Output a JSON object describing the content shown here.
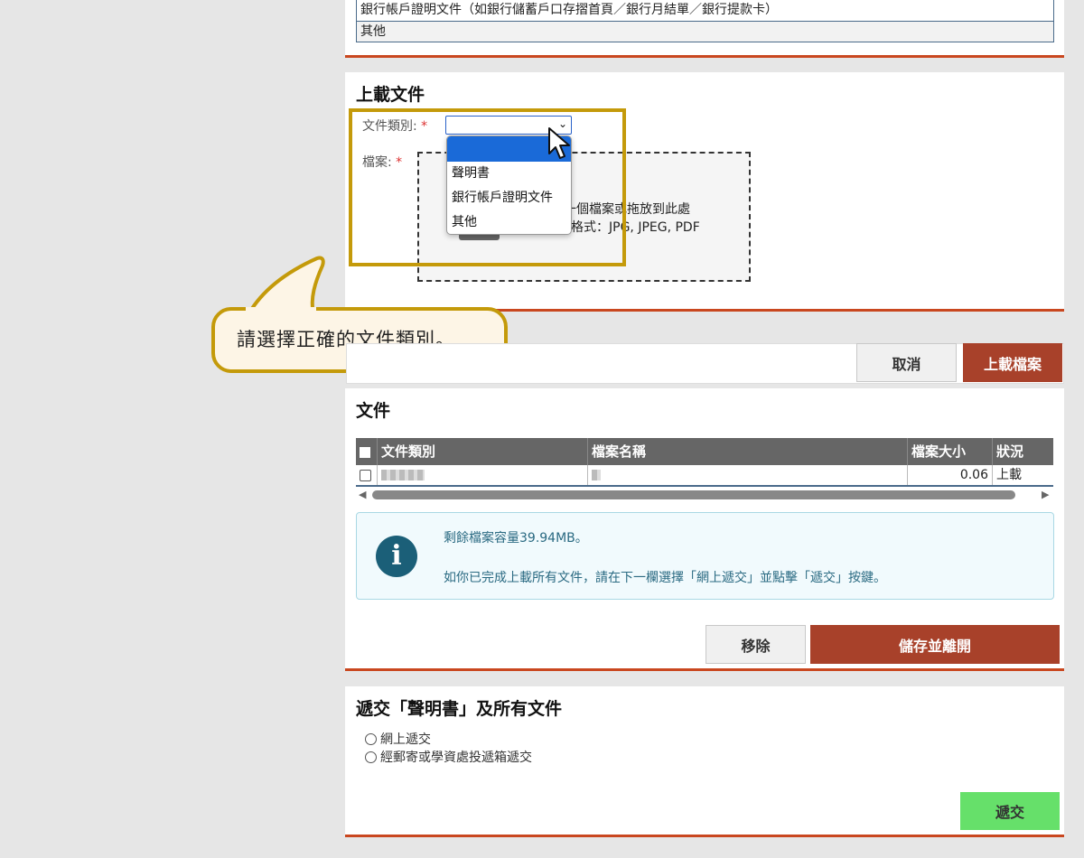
{
  "top_list": {
    "items": [
      "銀行帳戶證明文件（如銀行儲蓄戶口存摺首頁／銀行月結單／銀行提款卡）",
      "其他"
    ]
  },
  "upload_section": {
    "title": "上載文件",
    "category_label": "文件類別:",
    "file_label": "檔案:",
    "required_mark": "*",
    "select_value": "",
    "dropdown_options": [
      "",
      "聲明書",
      "銀行帳戶證明文件",
      "其他"
    ],
    "drop_zone_line1": "一個檔案或拖放到此處",
    "drop_zone_line2": "格式：JPG, JPEG, PDF"
  },
  "callout": {
    "text": "請選擇正確的文件類別。",
    "border_color": "#c49a0a"
  },
  "upload_actions": {
    "cancel_label": "取消",
    "upload_label": "上載檔案"
  },
  "documents": {
    "title": "文件",
    "columns": [
      "文件類別",
      "檔案名稱",
      "檔案大小",
      "狀況"
    ],
    "rows": [
      {
        "category": "",
        "filename": "",
        "size": "0.06",
        "status": "上載"
      }
    ],
    "info_line1": "剩餘檔案容量39.94MB。",
    "info_line2": "如你已完成上載所有文件，請在下一欄選擇「網上遞交」並點擊「遞交」按鍵。",
    "remove_label": "移除",
    "save_exit_label": "儲存並離開"
  },
  "submit_section": {
    "title": "遞交「聲明書」及所有文件",
    "options": [
      "網上遞交",
      "經郵寄或學資處投遞箱遞交"
    ],
    "submit_label": "遞交"
  },
  "colors": {
    "accent_rule": "#c9471f",
    "primary_button": "#a8412a",
    "submit_button": "#66e06a",
    "table_header": "#666666"
  }
}
